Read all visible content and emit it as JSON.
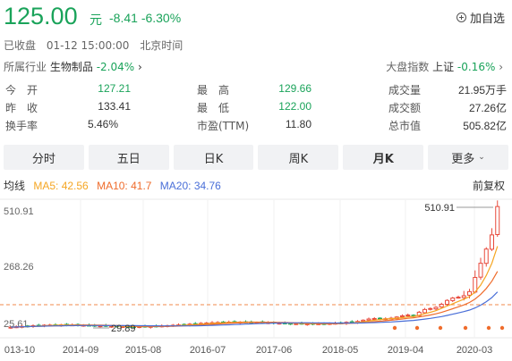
{
  "header": {
    "price": "125.00",
    "unit": "元",
    "change": "-8.41",
    "change_pct": "-6.30%",
    "watch_label": "加自选"
  },
  "status": {
    "state": "已收盘",
    "datetime": "01-12 15:00:00",
    "timezone": "北京时间"
  },
  "industry": {
    "label": "所属行业",
    "name": "生物制品",
    "change": "-2.04%",
    "chevron": "›"
  },
  "market_index": {
    "label": "大盘指数",
    "name": "上证",
    "change": "-0.16%",
    "chevron": "›"
  },
  "stats": {
    "open_label": "今　开",
    "open": "127.21",
    "prev_label": "昨　收",
    "prev": "133.41",
    "turnover_label": "换手率",
    "turnover": "5.46%",
    "high_label": "最　高",
    "high": "129.66",
    "low_label": "最　低",
    "low": "122.00",
    "pe_label": "市盈(TTM)",
    "pe": "11.80",
    "volume_label": "成交量",
    "volume": "21.95万手",
    "amount_label": "成交额",
    "amount": "27.26亿",
    "mcap_label": "总市值",
    "mcap": "505.82亿"
  },
  "tabs": [
    {
      "label": "分时"
    },
    {
      "label": "五日"
    },
    {
      "label": "日K"
    },
    {
      "label": "周K"
    },
    {
      "label": "月K",
      "active": true
    },
    {
      "label": "更多"
    }
  ],
  "ma": {
    "avg_label": "均线",
    "ma5": "MA5: 42.56",
    "ma10": "MA10: 41.7",
    "ma20": "MA20: 34.76",
    "adjust": "前复权",
    "colors": {
      "ma5": "#f5a623",
      "ma10": "#ef6c2c",
      "ma20": "#4a6fd8"
    }
  },
  "chart_data": {
    "type": "candlestick",
    "y_labels": [
      "510.91",
      "268.26",
      "25.61"
    ],
    "x_labels": [
      "013-10",
      "2014-09",
      "2015-08",
      "2016-07",
      "2017-06",
      "2018-05",
      "2019-04",
      "2020-03"
    ],
    "max_label": "510.91",
    "min_label": "29.89",
    "ylim": [
      25.61,
      510.91
    ],
    "colors": {
      "up": "#e84a3c",
      "down": "#1aa35a",
      "ma5": "#f5a623",
      "ma10": "#ef6c2c",
      "ma20": "#4a6fd8",
      "ref_line": "#f08a4b"
    }
  }
}
